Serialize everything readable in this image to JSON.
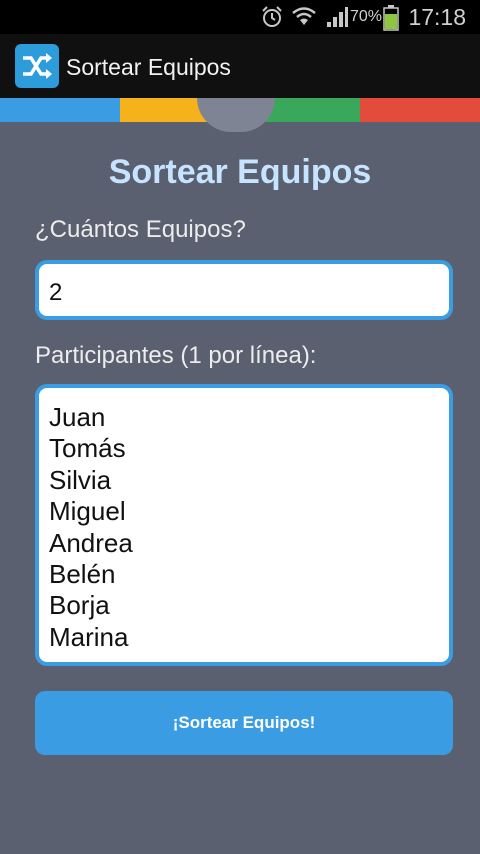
{
  "status_bar": {
    "time": "17:18",
    "battery_percent": "70%",
    "icons": [
      "alarm-icon",
      "wifi-icon",
      "signal-icon",
      "battery-icon"
    ]
  },
  "action_bar": {
    "title": "Sortear Equipos",
    "icon": "shuffle-icon"
  },
  "colors": {
    "strip": [
      "#3a9ce2",
      "#f5b21b",
      "#3aa85a",
      "#e34b3b"
    ],
    "accent": "#3a9ce2",
    "background": "#5b6070"
  },
  "main": {
    "heading": "Sortear Equipos",
    "teams_label": "¿Cuántos Equipos?",
    "teams_value": "2",
    "participants_label": "Participantes (1 por línea):",
    "participants": [
      "Juan",
      "Tomás",
      "Silvia",
      "Miguel",
      "Andrea",
      "Belén",
      "Borja",
      "Marina"
    ],
    "submit_label": "¡Sortear Equipos!"
  }
}
